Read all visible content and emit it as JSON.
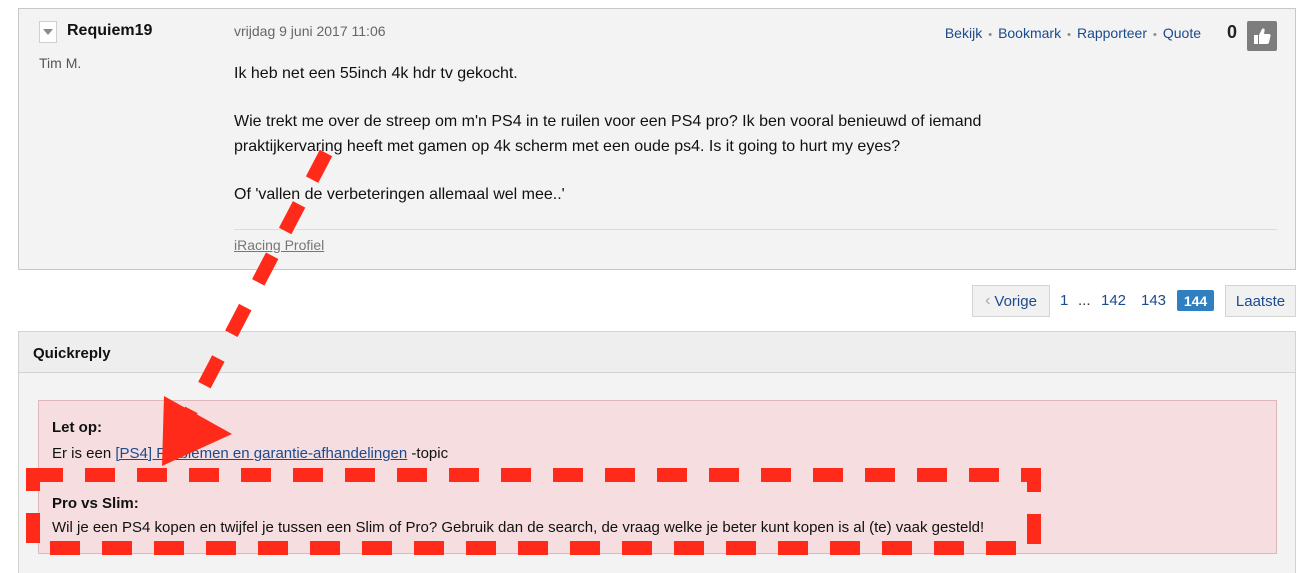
{
  "post": {
    "username": "Requiem19",
    "realname": "Tim M.",
    "date": "vrijdag 9 juni 2017 11:06",
    "actions": [
      "Bekijk",
      "Bookmark",
      "Rapporteer",
      "Quote"
    ],
    "score": "0",
    "message": [
      "Ik heb net een 55inch 4k hdr tv gekocht.",
      "Wie trekt me over de streep om m'n PS4 in te ruilen voor een PS4 pro? Ik ben vooral benieuwd of iemand",
      "praktijkervaring heeft met gamen op 4k scherm met een oude ps4. Is it going to hurt my eyes?",
      "Of 'vallen de verbeteringen allemaal wel mee..'"
    ],
    "signature": "iRacing Profiel"
  },
  "pagination": {
    "prev": "Vorige",
    "first": "1",
    "ellipsis": "...",
    "pages": [
      "142",
      "143"
    ],
    "current": "144",
    "last": "Laatste"
  },
  "quickreply": {
    "title": "Quickreply",
    "notice": {
      "heading1": "Let op:",
      "text1_pre": "Er is een",
      "text1_link": "[PS4] Problemen en garantie-afhandelingen",
      "text1_post": "-topic",
      "heading2": "Pro vs Slim:",
      "text2": "Wil je een PS4 kopen en twijfel je tussen een Slim of Pro? Gebruik dan de search, de vraag welke je beter kunt kopen is al (te) vaak gesteld!"
    }
  },
  "colors": {
    "link": "#1a4b8c",
    "current_page": "#2f7fc1",
    "notice_bg": "#f5dde0",
    "annotation": "#ff2a1a"
  },
  "icons": [
    "chevron-down-icon",
    "thumbs-up-icon",
    "chevron-left-icon"
  ]
}
